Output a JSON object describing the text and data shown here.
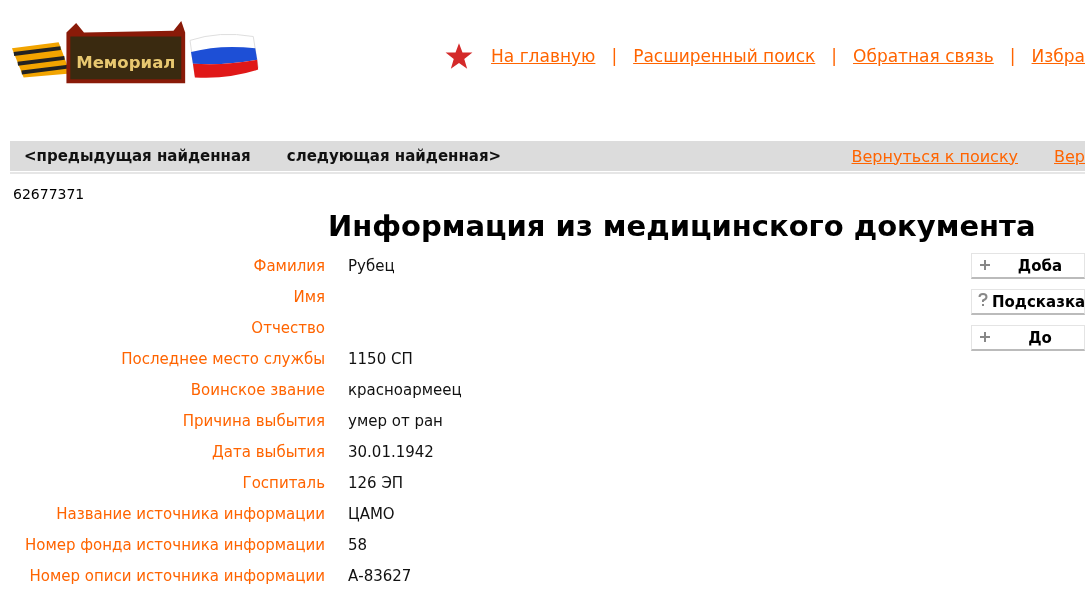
{
  "logo": {
    "text": "Мемориал"
  },
  "nav": {
    "links": [
      "На главную",
      "Расширенный поиск",
      "Обратная связь",
      "Избра"
    ],
    "separator": "|"
  },
  "toolbar": {
    "prev": "<предыдущая найденная",
    "next": "следующая найденная>",
    "links": [
      "Вернуться к поиску",
      "Вер"
    ]
  },
  "record_id": "62677371",
  "title": "Информация из медицинского документа",
  "fields": [
    {
      "label": "Фамилия",
      "value": "Рубец"
    },
    {
      "label": "Имя"
    },
    {
      "label": "Отчество"
    },
    {
      "label": "Последнее место службы",
      "value": "1150 СП"
    },
    {
      "label": "Воинское звание",
      "value": "красноармеец"
    },
    {
      "label": "Причина выбытия",
      "value": "умер от ран"
    },
    {
      "label": "Дата выбытия",
      "value": "30.01.1942"
    },
    {
      "label": "Госпиталь",
      "value": "126 ЭП"
    },
    {
      "label": "Название источника информации",
      "value": "ЦАМО"
    },
    {
      "label": "Номер фонда источника информации",
      "value": "58"
    },
    {
      "label": "Номер описи источника информации",
      "value": "А-83627"
    }
  ],
  "side_buttons": [
    {
      "kind": "plus",
      "label": "Доба"
    },
    {
      "kind": "help",
      "label": "Подсказка"
    },
    {
      "kind": "plus",
      "label": "До"
    }
  ]
}
